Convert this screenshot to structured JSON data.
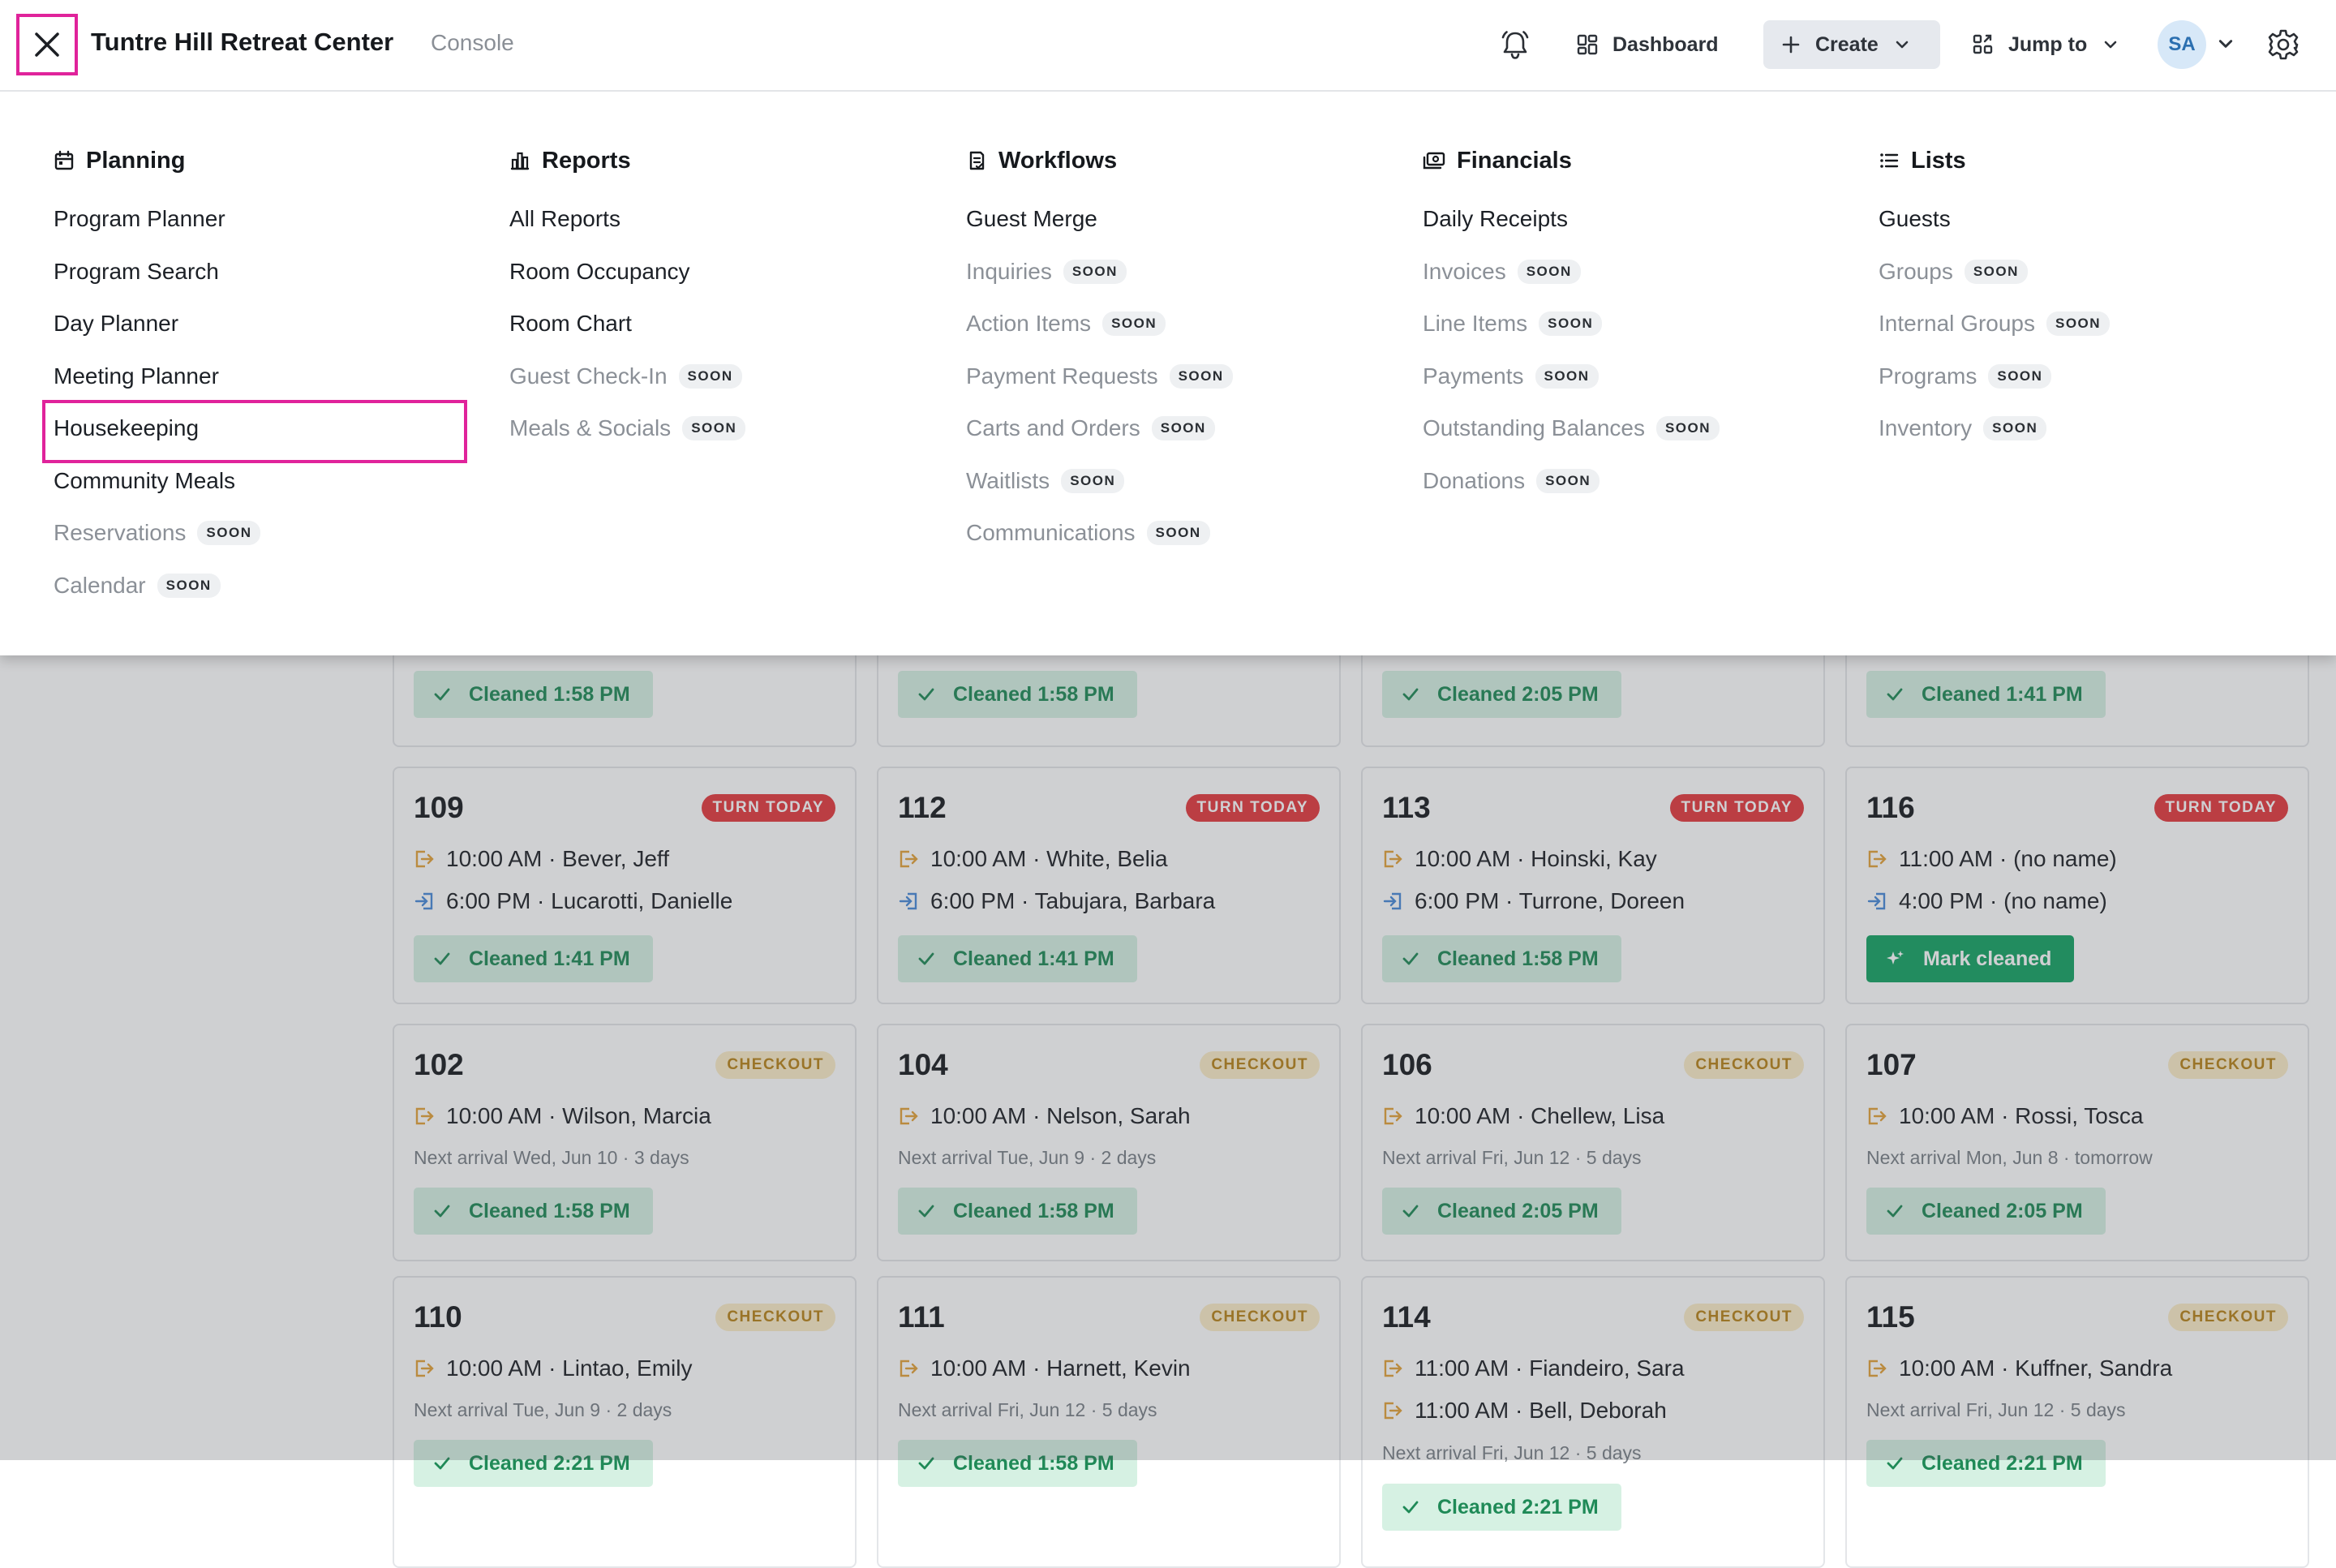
{
  "header": {
    "title": "Tuntre Hill Retreat Center",
    "subtitle": "Console",
    "dashboard_label": "Dashboard",
    "create_label": "Create",
    "jump_label": "Jump to",
    "avatar_initials": "SA"
  },
  "menu": {
    "planning": {
      "title": "Planning",
      "items": [
        {
          "label": "Program Planner"
        },
        {
          "label": "Program Search"
        },
        {
          "label": "Day Planner"
        },
        {
          "label": "Meeting Planner"
        },
        {
          "label": "Housekeeping"
        },
        {
          "label": "Community Meals"
        },
        {
          "label": "Reservations",
          "soon": "SOON"
        },
        {
          "label": "Calendar",
          "soon": "SOON"
        }
      ]
    },
    "reports": {
      "title": "Reports",
      "items": [
        {
          "label": "All Reports"
        },
        {
          "label": "Room Occupancy"
        },
        {
          "label": "Room Chart"
        },
        {
          "label": "Guest Check-In",
          "soon": "SOON"
        },
        {
          "label": "Meals & Socials",
          "soon": "SOON"
        }
      ]
    },
    "workflows": {
      "title": "Workflows",
      "items": [
        {
          "label": "Guest Merge"
        },
        {
          "label": "Inquiries",
          "soon": "SOON"
        },
        {
          "label": "Action Items",
          "soon": "SOON"
        },
        {
          "label": "Payment Requests",
          "soon": "SOON"
        },
        {
          "label": "Carts and Orders",
          "soon": "SOON"
        },
        {
          "label": "Waitlists",
          "soon": "SOON"
        },
        {
          "label": "Communications",
          "soon": "SOON"
        }
      ]
    },
    "financials": {
      "title": "Financials",
      "items": [
        {
          "label": "Daily Receipts"
        },
        {
          "label": "Invoices",
          "soon": "SOON"
        },
        {
          "label": "Line Items",
          "soon": "SOON"
        },
        {
          "label": "Payments",
          "soon": "SOON"
        },
        {
          "label": "Outstanding Balances",
          "soon": "SOON"
        },
        {
          "label": "Donations",
          "soon": "SOON"
        }
      ]
    },
    "lists": {
      "title": "Lists",
      "items": [
        {
          "label": "Guests"
        },
        {
          "label": "Groups",
          "soon": "SOON"
        },
        {
          "label": "Internal Groups",
          "soon": "SOON"
        },
        {
          "label": "Programs",
          "soon": "SOON"
        },
        {
          "label": "Inventory",
          "soon": "SOON"
        }
      ]
    }
  },
  "board": {
    "top_row": [
      "Cleaned 1:58 PM",
      "Cleaned 1:58 PM",
      "Cleaned 2:05 PM",
      "Cleaned 1:41 PM"
    ],
    "turn_row": [
      {
        "room": "109",
        "badge": "TURN TODAY",
        "out": "10:00 AM · Bever, Jeff",
        "in": "6:00 PM · Lucarotti, Danielle",
        "status": "Cleaned 1:41 PM"
      },
      {
        "room": "112",
        "badge": "TURN TODAY",
        "out": "10:00 AM · White, Belia",
        "in": "6:00 PM · Tabujara, Barbara",
        "status": "Cleaned 1:41 PM"
      },
      {
        "room": "113",
        "badge": "TURN TODAY",
        "out": "10:00 AM · Hoinski, Kay",
        "in": "6:00 PM · Turrone, Doreen",
        "status": "Cleaned 1:58 PM"
      },
      {
        "room": "116",
        "badge": "TURN TODAY",
        "out": "11:00 AM · (no name)",
        "in": "4:00 PM · (no name)",
        "status": "Mark cleaned"
      }
    ],
    "checkout_row": [
      {
        "room": "102",
        "badge": "CHECKOUT",
        "out": "10:00 AM · Wilson, Marcia",
        "next": "Next arrival Wed, Jun 10 · 3 days",
        "status": "Cleaned 1:58 PM"
      },
      {
        "room": "104",
        "badge": "CHECKOUT",
        "out": "10:00 AM · Nelson, Sarah",
        "next": "Next arrival Tue, Jun 9 · 2 days",
        "status": "Cleaned 1:58 PM"
      },
      {
        "room": "106",
        "badge": "CHECKOUT",
        "out": "10:00 AM · Chellew, Lisa",
        "next": "Next arrival Fri, Jun 12 · 5 days",
        "status": "Cleaned 2:05 PM"
      },
      {
        "room": "107",
        "badge": "CHECKOUT",
        "out": "10:00 AM · Rossi, Tosca",
        "next": "Next arrival Mon, Jun 8 · tomorrow",
        "status": "Cleaned 2:05 PM"
      }
    ],
    "last_row": [
      {
        "room": "110",
        "badge": "CHECKOUT",
        "out": "10:00 AM · Lintao, Emily",
        "next": "Next arrival Tue, Jun 9 · 2 days",
        "status": "Cleaned 2:21 PM"
      },
      {
        "room": "111",
        "badge": "CHECKOUT",
        "out": "10:00 AM · Harnett, Kevin",
        "next": "Next arrival Fri, Jun 12 · 5 days",
        "status": "Cleaned 1:58 PM"
      },
      {
        "room": "114",
        "badge": "CHECKOUT",
        "out": "11:00 AM · Fiandeiro, Sara",
        "out2": "11:00 AM · Bell, Deborah",
        "next": "Next arrival Fri, Jun 12 · 5 days",
        "status": "Cleaned 2:21 PM"
      },
      {
        "room": "115",
        "badge": "CHECKOUT",
        "out": "10:00 AM · Kuffner, Sandra",
        "next": "Next arrival Fri, Jun 12 · 5 days",
        "status": "Cleaned 2:21 PM"
      }
    ]
  },
  "colors": {
    "highlight": "#e0239b",
    "turn_badge": "#e53a3f",
    "checkout_badge_bg": "#fbedc8",
    "cleaned_bg": "#d6f1e3",
    "mark_cleaned": "#16a465"
  },
  "icons": [
    "close-icon",
    "bell-icon",
    "dashboard-icon",
    "plus-icon",
    "chevron-down-icon",
    "jump-icon",
    "gear-icon",
    "calendar-icon",
    "reports-icon",
    "workflows-icon",
    "financials-icon",
    "lists-icon",
    "checkout-icon",
    "checkin-icon",
    "check-icon",
    "sparkle-icon"
  ]
}
